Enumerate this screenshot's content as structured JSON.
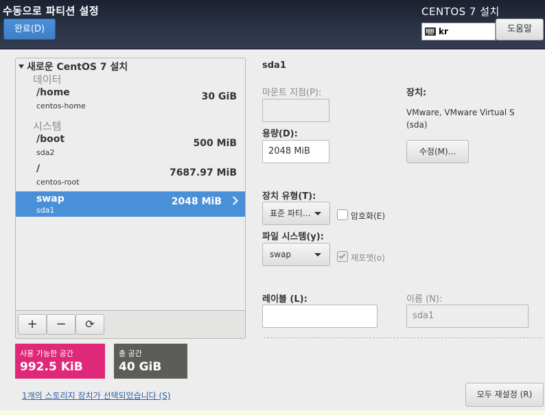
{
  "header": {
    "page_title": "수동으로 파티션 설정",
    "done_label": "완료(D)",
    "product_title": "CENTOS 7 설치",
    "keyboard_layout": "kr",
    "help_label": "도움말"
  },
  "tree": {
    "title": "새로운 CentOS 7 설치",
    "groups": [
      {
        "label": "데이터"
      },
      {
        "label": "시스템"
      }
    ],
    "mounts": [
      {
        "name": "/home",
        "device": "centos-home",
        "size": "30 GiB"
      },
      {
        "name": "/boot",
        "device": "sda2",
        "size": "500 MiB"
      },
      {
        "name": "/",
        "device": "centos-root",
        "size": "7687.97 MiB"
      },
      {
        "name": "swap",
        "device": "sda1",
        "size": "2048 MiB"
      }
    ],
    "toolbar": {
      "add": "+",
      "remove": "−",
      "refresh": "⟳"
    }
  },
  "space": {
    "available_label": "사용 가능한 공간",
    "available_value": "992.5 KiB",
    "total_label": "총 공간",
    "total_value": "40 GiB",
    "available_color": "#e0287a",
    "total_color": "#5c5c58"
  },
  "storage_link": "1개의 스토리지 장치가 선택되었습니다 (S)",
  "detail": {
    "device_title": "sda1",
    "mount_point_label": "마운트 지점(P):",
    "mount_point_value": "",
    "capacity_label": "용량(D):",
    "capacity_value": "2048 MiB",
    "device_label": "장치:",
    "device_name": "VMware, VMware Virtual S",
    "device_id": "(sda)",
    "modify_label": "수정(M)...",
    "device_type_label": "장치 유형(T):",
    "device_type_value": "표준 파티...",
    "encrypt_label": "암호화(E)",
    "filesystem_label": "파일 시스템(y):",
    "filesystem_value": "swap",
    "reformat_label": "재포맷(o)",
    "label_label": "레이블 (L):",
    "label_value": "",
    "name_label": "이름 (N):",
    "name_value": "sda1",
    "reset_all_label": "모두 재설정 (R)"
  }
}
